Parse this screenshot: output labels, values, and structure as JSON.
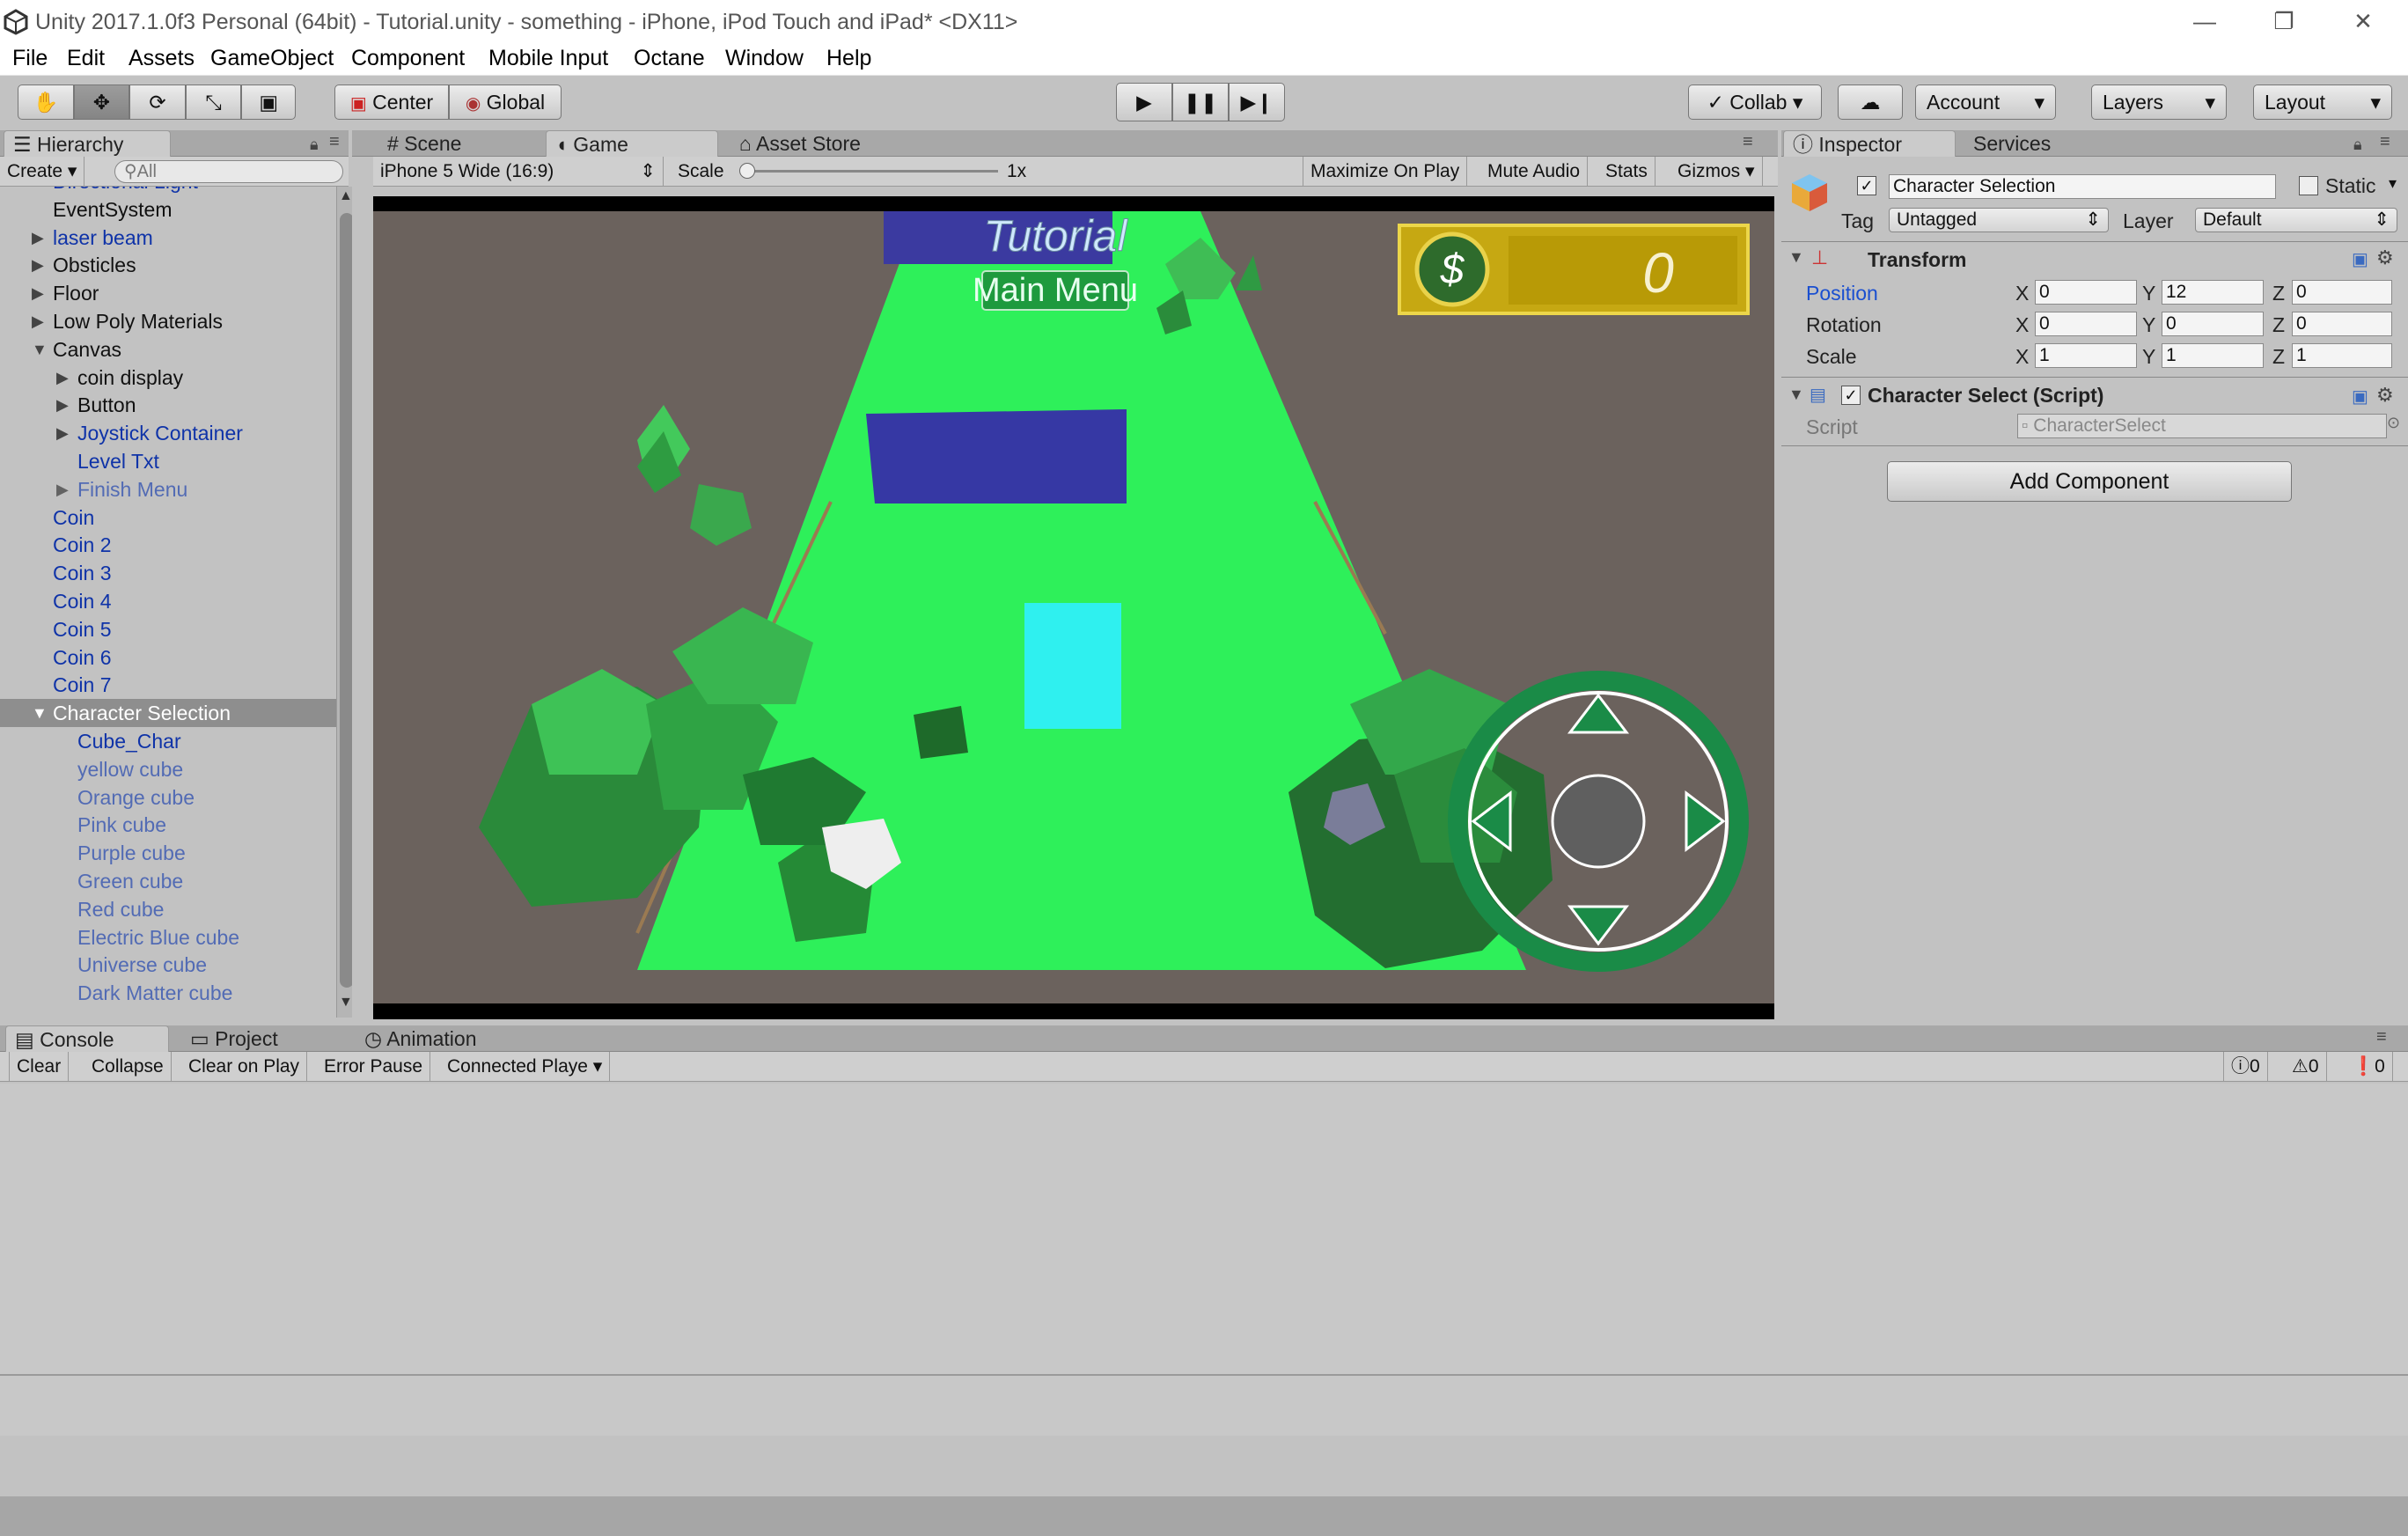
{
  "window": {
    "title": "Unity 2017.1.0f3 Personal (64bit) - Tutorial.unity - something - iPhone, iPod Touch and iPad* <DX11>",
    "minimize": "—",
    "restore": "❐",
    "close": "✕"
  },
  "menu": [
    "File",
    "Edit",
    "Assets",
    "GameObject",
    "Component",
    "Mobile Input",
    "Octane",
    "Window",
    "Help"
  ],
  "toolbar": {
    "pivot": "Center",
    "space": "Global",
    "collab": "Collab",
    "account": "Account",
    "layers": "Layers",
    "layout": "Layout",
    "icons": {
      "hand": "✋",
      "move": "✥",
      "rotate": "⟳",
      "scale": "⤡",
      "rect": "▣",
      "play": "▶",
      "pause": "❚❚",
      "step": "▶❙",
      "cloud": "☁"
    }
  },
  "hierarchy": {
    "tab": "Hierarchy",
    "create": "Create",
    "search_placeholder": "All",
    "items": [
      {
        "label": "Directional Light",
        "indent": 1,
        "style": "blue"
      },
      {
        "label": "EventSystem",
        "indent": 1,
        "style": "normal"
      },
      {
        "label": "laser beam",
        "indent": 1,
        "style": "blue",
        "arrow": "▶"
      },
      {
        "label": "Obsticles",
        "indent": 1,
        "style": "normal",
        "arrow": "▶"
      },
      {
        "label": "Floor",
        "indent": 1,
        "style": "normal",
        "arrow": "▶"
      },
      {
        "label": "Low Poly Materials",
        "indent": 1,
        "style": "normal",
        "arrow": "▶"
      },
      {
        "label": "Canvas",
        "indent": 1,
        "style": "normal",
        "arrow": "▼"
      },
      {
        "label": "coin display",
        "indent": 2,
        "style": "normal",
        "arrow": "▶"
      },
      {
        "label": "Button",
        "indent": 2,
        "style": "normal",
        "arrow": "▶"
      },
      {
        "label": "Joystick Container",
        "indent": 2,
        "style": "blue",
        "arrow": "▶"
      },
      {
        "label": "Level Txt",
        "indent": 2,
        "style": "blue"
      },
      {
        "label": "Finish Menu",
        "indent": 2,
        "style": "dim",
        "arrow": "▶"
      },
      {
        "label": "Coin",
        "indent": 1,
        "style": "blue"
      },
      {
        "label": "Coin 2",
        "indent": 1,
        "style": "blue"
      },
      {
        "label": "Coin 3",
        "indent": 1,
        "style": "blue"
      },
      {
        "label": "Coin 4",
        "indent": 1,
        "style": "blue"
      },
      {
        "label": "Coin 5",
        "indent": 1,
        "style": "blue"
      },
      {
        "label": "Coin 6",
        "indent": 1,
        "style": "blue"
      },
      {
        "label": "Coin 7",
        "indent": 1,
        "style": "blue"
      },
      {
        "label": "Character Selection",
        "indent": 1,
        "style": "sel",
        "arrow": "▼"
      },
      {
        "label": "Cube_Char",
        "indent": 2,
        "style": "blue"
      },
      {
        "label": "yellow cube",
        "indent": 2,
        "style": "dim"
      },
      {
        "label": "Orange cube",
        "indent": 2,
        "style": "dim"
      },
      {
        "label": "Pink cube",
        "indent": 2,
        "style": "dim"
      },
      {
        "label": "Purple cube",
        "indent": 2,
        "style": "dim"
      },
      {
        "label": "Green cube",
        "indent": 2,
        "style": "dim"
      },
      {
        "label": "Red cube",
        "indent": 2,
        "style": "dim"
      },
      {
        "label": "Electric Blue cube",
        "indent": 2,
        "style": "dim"
      },
      {
        "label": "Universe cube",
        "indent": 2,
        "style": "dim"
      },
      {
        "label": "Dark Matter cube",
        "indent": 2,
        "style": "dim"
      }
    ]
  },
  "center_tabs": {
    "scene": "Scene",
    "game": "Game",
    "asset_store": "Asset Store"
  },
  "game_bar": {
    "resolution": "iPhone 5 Wide (16:9)",
    "scale_label": "Scale",
    "scale_value": "1x",
    "maximize": "Maximize On Play",
    "mute": "Mute Audio",
    "stats": "Stats",
    "gizmos": "Gizmos"
  },
  "game_view": {
    "title_text": "Tutorial",
    "menu_button": "Main Menu",
    "coin_symbol": "$",
    "coin_count": "0"
  },
  "inspector": {
    "tab": "Inspector",
    "services": "Services",
    "object_name": "Character Selection",
    "static_label": "Static",
    "tag_label": "Tag",
    "tag_value": "Untagged",
    "layer_label": "Layer",
    "layer_value": "Default",
    "transform": {
      "title": "Transform",
      "rows": [
        {
          "label": "Position",
          "x": "0",
          "y": "12",
          "z": "0"
        },
        {
          "label": "Rotation",
          "x": "0",
          "y": "0",
          "z": "0"
        },
        {
          "label": "Scale",
          "x": "1",
          "y": "1",
          "z": "1"
        }
      ],
      "axis": {
        "x": "X",
        "y": "Y",
        "z": "Z"
      }
    },
    "script_component": {
      "title": "Character Select (Script)",
      "script_label": "Script",
      "script_value": "CharacterSelect"
    },
    "add_component": "Add Component"
  },
  "bottom_tabs": {
    "console": "Console",
    "project": "Project",
    "animation": "Animation"
  },
  "console_bar": {
    "clear": "Clear",
    "collapse": "Collapse",
    "clear_on_play": "Clear on Play",
    "error_pause": "Error Pause",
    "connected_player": "Connected Playe",
    "log_count": "0",
    "warn_count": "0",
    "error_count": "0"
  },
  "colors": {
    "panel": "#c2c2c2",
    "tab_bar": "#a8a8a8",
    "blue_text": "#0f33a8",
    "selection": "#8e8e8e",
    "ground": "#2ef05a",
    "sky": "#6b625d"
  }
}
